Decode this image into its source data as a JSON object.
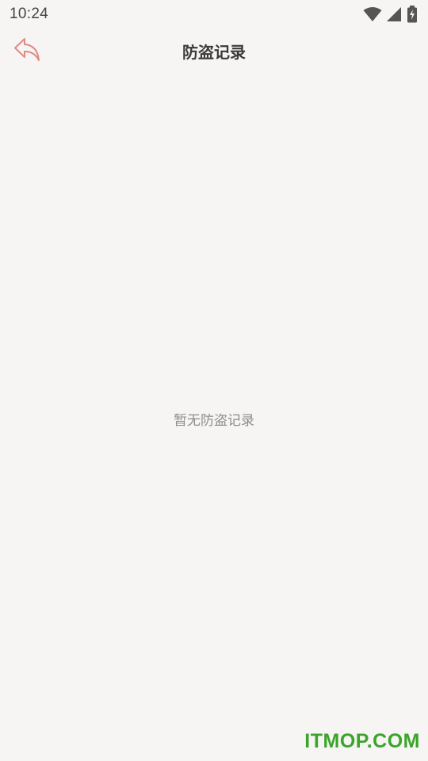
{
  "status_bar": {
    "time": "10:24",
    "icons": [
      "wifi-icon",
      "signal-icon",
      "battery-charging-icon"
    ]
  },
  "header": {
    "title": "防盗记录",
    "back_icon": "back-arrow-icon"
  },
  "main": {
    "empty_message": "暂无防盗记录"
  },
  "watermark": {
    "text": "ITMOP.COM"
  },
  "colors": {
    "background": "#f7f5f4",
    "back_icon": "#e08a86",
    "title": "#3a3a3a",
    "empty_text": "#8c8c8c",
    "watermark": "#3aa52a"
  }
}
